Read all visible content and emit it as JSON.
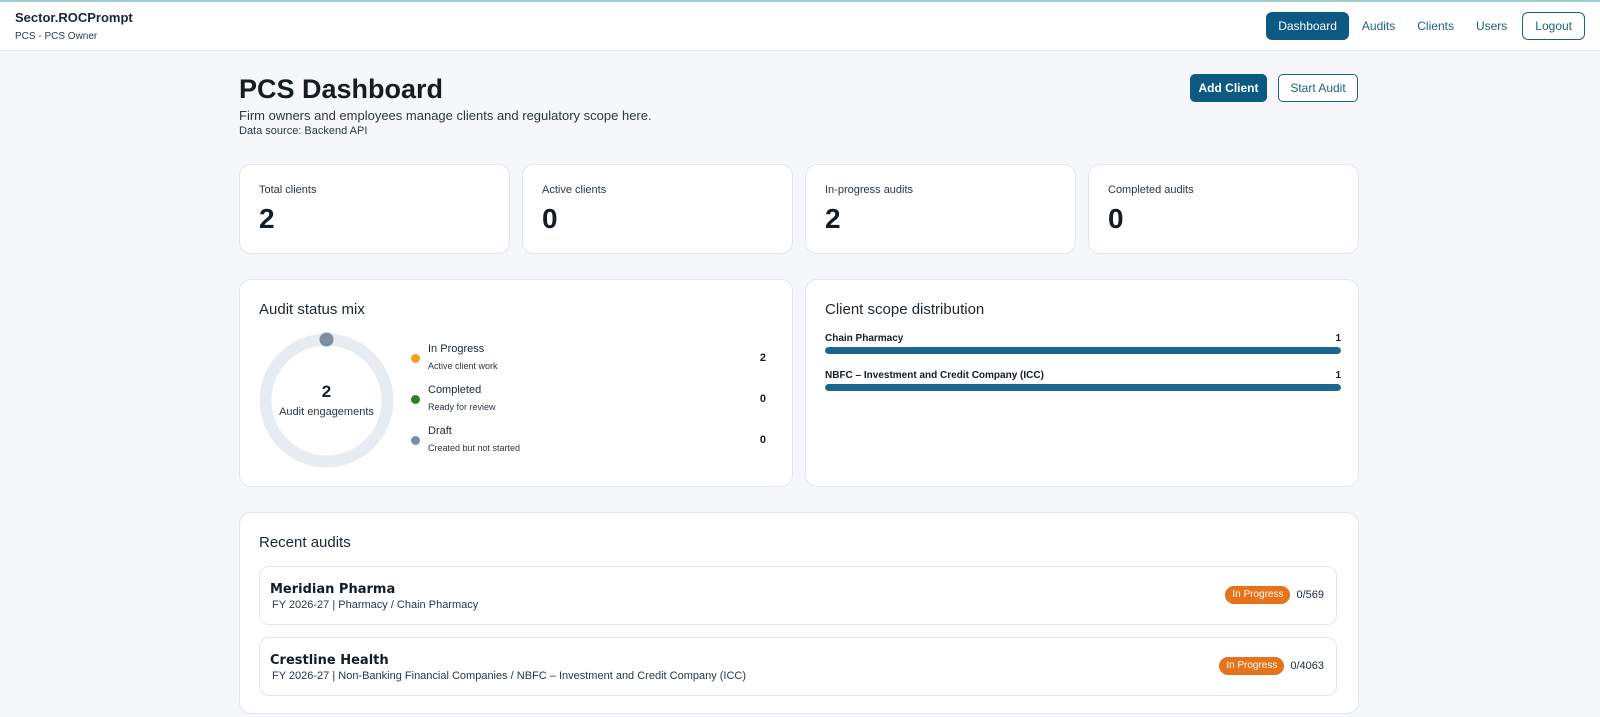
{
  "app": {
    "name": "Sector.ROCPrompt",
    "role": "PCS - PCS Owner"
  },
  "nav": {
    "items": [
      "Dashboard",
      "Audits",
      "Clients",
      "Users"
    ],
    "active": "Dashboard",
    "logout": "Logout"
  },
  "header": {
    "title": "PCS Dashboard",
    "subtitle": "Firm owners and employees manage clients and regulatory scope here.",
    "source": "Data source: Backend API",
    "add_client": "Add Client",
    "start_audit": "Start Audit"
  },
  "stats": [
    {
      "label": "Total clients",
      "value": "2"
    },
    {
      "label": "Active clients",
      "value": "0"
    },
    {
      "label": "In-progress audits",
      "value": "2"
    },
    {
      "label": "Completed audits",
      "value": "0"
    }
  ],
  "status_mix": {
    "title": "Audit status mix",
    "total": "2",
    "total_label": "Audit engagements",
    "items": [
      {
        "name": "In Progress",
        "desc": "Active client work",
        "count": "2",
        "color": "#f0a221"
      },
      {
        "name": "Completed",
        "desc": "Ready for review",
        "count": "0",
        "color": "#2e7d32"
      },
      {
        "name": "Draft",
        "desc": "Created but not started",
        "count": "0",
        "color": "#7d8e9e"
      }
    ]
  },
  "scope": {
    "title": "Client scope distribution",
    "items": [
      {
        "name": "Chain Pharmacy",
        "count": "1",
        "fraction": 1.0
      },
      {
        "name": "NBFC – Investment and Credit Company (ICC)",
        "count": "1",
        "fraction": 1.0
      }
    ]
  },
  "recent": {
    "title": "Recent audits",
    "items": [
      {
        "name": "Meridian Pharma",
        "meta": "FY 2026-27 | Pharmacy / Chain Pharmacy",
        "status": "In Progress",
        "progress": "0/569"
      },
      {
        "name": "Crestline Health",
        "meta": "FY 2026-27 | Non-Banking Financial Companies / NBFC – Investment and Credit Company (ICC)",
        "status": "In Progress",
        "progress": "0/4063"
      }
    ]
  }
}
